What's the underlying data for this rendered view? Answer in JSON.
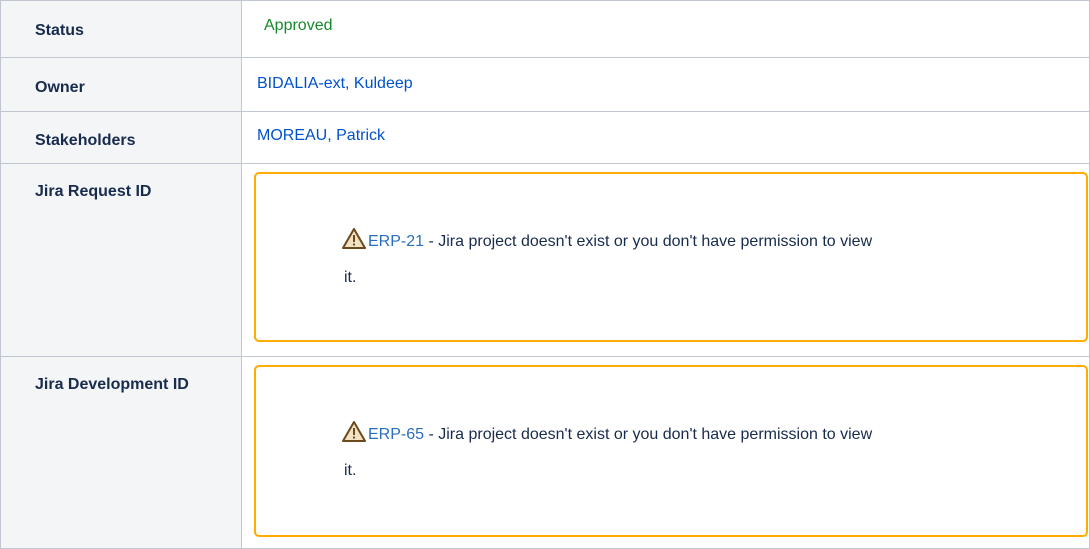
{
  "rows": [
    {
      "label": "Status",
      "value": "Approved"
    },
    {
      "label": "Owner",
      "value": "BIDALIA-ext, Kuldeep"
    },
    {
      "label": "Stakeholders",
      "value": "MOREAU, Patrick"
    },
    {
      "label": "Jira Request ID",
      "issue_key": "ERP-21",
      "message": " - Jira project doesn't exist or you don't have permission to view",
      "message_cont": "it."
    },
    {
      "label": "Jira Development ID",
      "issue_key": "ERP-65",
      "message": " - Jira project doesn't exist or you don't have permission to view",
      "message_cont": "it."
    }
  ],
  "colors": {
    "status_approved": "#14892c",
    "link": "#0052cc",
    "warning_border": "#ffab00",
    "warning_icon": "#6b4a1e"
  }
}
